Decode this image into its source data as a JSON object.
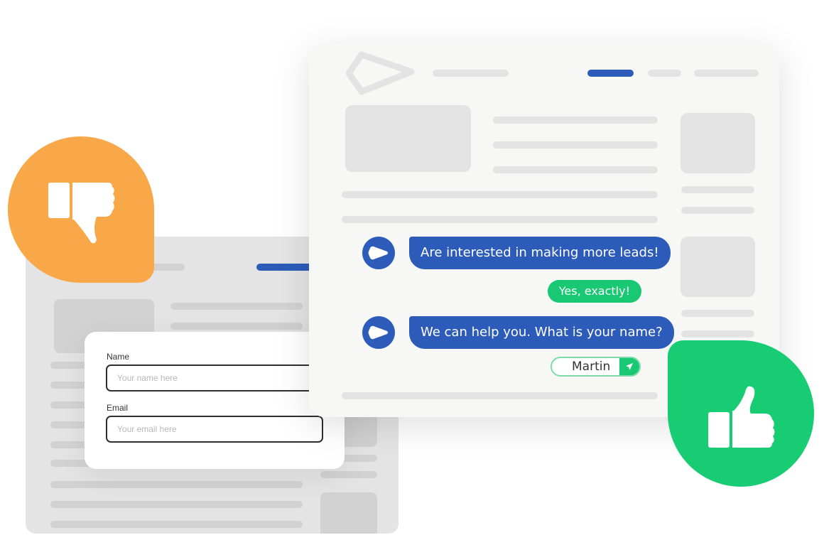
{
  "colors": {
    "brand_blue": "#2c5bba",
    "success_green": "#18c873",
    "warning_orange": "#f8a848",
    "placeholder_gray": "#e3e3e3"
  },
  "form": {
    "name_label": "Name",
    "name_placeholder": "Your name here",
    "email_label": "Email",
    "email_placeholder": "Your email here"
  },
  "chat": {
    "messages": [
      {
        "sender": "bot",
        "text": "Are interested in making more leads!"
      },
      {
        "sender": "user",
        "text": "Yes, exactly!"
      },
      {
        "sender": "bot",
        "text": "We can help you. What is your name?"
      }
    ],
    "reply_value": "Martin",
    "send_icon": "paper-plane-icon"
  },
  "badges": {
    "dislike_icon": "thumbs-down-icon",
    "like_icon": "thumbs-up-icon"
  }
}
